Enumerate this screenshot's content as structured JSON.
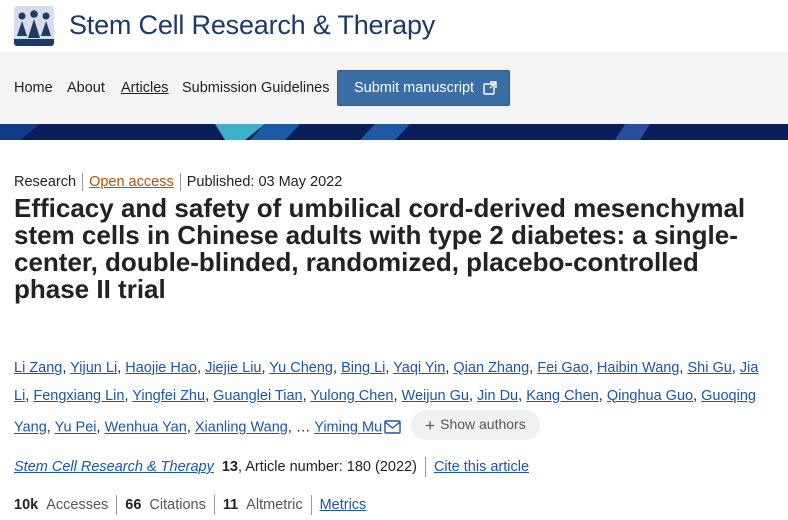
{
  "header": {
    "journal_title": "Stem Cell Research & Therapy",
    "logo_icon": "people-logo-icon"
  },
  "nav": {
    "items": [
      {
        "label": "Home",
        "active": false
      },
      {
        "label": "About",
        "active": false
      },
      {
        "label": "Articles",
        "active": true
      },
      {
        "label": "Submission Guidelines",
        "active": false
      }
    ],
    "submit_label": "Submit manuscript",
    "submit_icon": "external-link-icon"
  },
  "article": {
    "type": "Research",
    "open_access": "Open access",
    "published": "Published: 03 May 2022",
    "title": "Efficacy and safety of umbilical cord-derived mesenchymal stem cells in Chinese adults with type 2 diabetes: a single-center, double-blinded, randomized, placebo-controlled phase II trial",
    "authors": [
      "Li Zang",
      "Yijun Li",
      "Haojie Hao",
      "Jiejie Liu",
      "Yu Cheng",
      "Bing Li",
      "Yaqi Yin",
      "Qian Zhang",
      "Fei Gao",
      "Haibin Wang",
      "Shi Gu",
      "Jia Li",
      "Fengxiang Lin",
      "Yingfei Zhu",
      "Guanglei Tian",
      "Yulong Chen",
      "Weijun Gu",
      "Jin Du",
      "Kang Chen",
      "Qinghua Guo",
      "Guoqing Yang",
      "Yu Pei",
      "Wenhua Yan",
      "Xianling Wang"
    ],
    "ellipsis": "…",
    "corresponding_author": "Yiming Mu",
    "show_authors_label": "Show authors"
  },
  "citation": {
    "journal": "Stem Cell Research & Therapy",
    "volume": "13",
    "article_number": ", Article number: 180 (2022)",
    "cite_label": "Cite this article"
  },
  "metrics": {
    "accesses_value": "10k",
    "accesses_label": "Accesses",
    "citations_value": "66",
    "citations_label": "Citations",
    "altmetric_value": "11",
    "altmetric_label": "Altmetric",
    "metrics_link": "Metrics"
  },
  "colors": {
    "brand_blue": "#1b3a66",
    "button_blue": "#3a6ea5",
    "link_blue": "#1a57a5",
    "open_access_orange": "#b45309",
    "banner_navy": "#0a1e5a"
  }
}
